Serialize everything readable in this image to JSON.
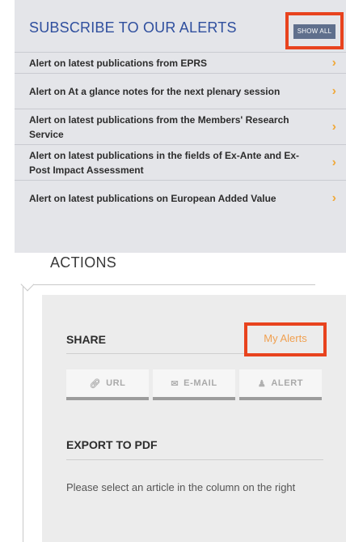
{
  "subscribe": {
    "title": "SUBSCRIBE TO OUR ALERTS",
    "show_all_label": "SHOW ALL",
    "items": [
      {
        "label": "Alert on latest publications from EPRS"
      },
      {
        "label": "Alert on At a glance notes for the next plenary session"
      },
      {
        "label": "Alert on latest publications from the Members' Research Service"
      },
      {
        "label": "Alert on latest publications in the fields of Ex-Ante and Ex-Post Impact Assessment"
      },
      {
        "label": "Alert on latest publications on European Added Value"
      }
    ]
  },
  "actions": {
    "title": "ACTIONS",
    "share": {
      "title": "SHARE",
      "my_alerts_label": "My Alerts",
      "buttons": [
        {
          "label": "URL",
          "icon": "link-icon"
        },
        {
          "label": "E-MAIL",
          "icon": "email-icon"
        },
        {
          "label": "ALERT",
          "icon": "bell-icon"
        }
      ]
    },
    "export": {
      "title": "EXPORT TO PDF",
      "note": "Please select an article in the column on the right"
    }
  },
  "colors": {
    "accent_blue": "#2f4f9e",
    "highlight_red": "#e8431e",
    "chevron_orange": "#f0a93a",
    "panel_gray": "#e4e5e9"
  }
}
